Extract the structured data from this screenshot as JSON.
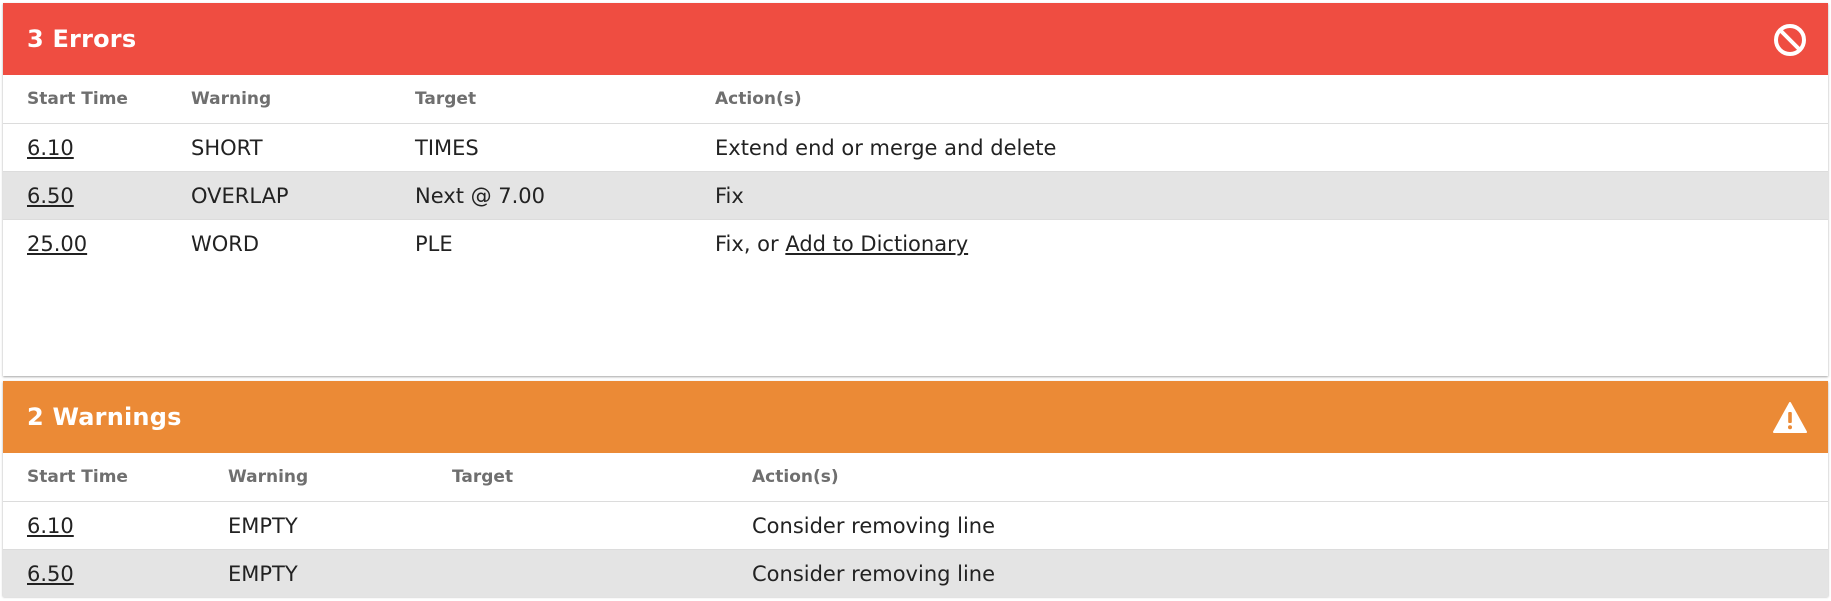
{
  "errors": {
    "title": "3 Errors",
    "header_color": "#ef4d41",
    "icon": "no-entry-icon",
    "columns": [
      "Start Time",
      "Warning",
      "Target",
      "Action(s)"
    ],
    "rows": [
      {
        "start_time": "6.10",
        "warning": "SHORT",
        "target": "TIMES",
        "action": "Extend end or merge and delete"
      },
      {
        "start_time": "6.50",
        "warning": "OVERLAP",
        "target": "Next @ 7.00",
        "action": "Fix"
      },
      {
        "start_time": "25.00",
        "warning": "WORD",
        "target": "PLE",
        "action_prefix": "Fix, or ",
        "action_link": "Add to Dictionary"
      }
    ]
  },
  "warnings": {
    "title": "2 Warnings",
    "header_color": "#eb8a36",
    "icon": "warning-triangle-icon",
    "columns": [
      "Start Time",
      "Warning",
      "Target",
      "Action(s)"
    ],
    "rows": [
      {
        "start_time": "6.10",
        "warning": "EMPTY",
        "target": "",
        "action": "Consider removing line"
      },
      {
        "start_time": "6.50",
        "warning": "EMPTY",
        "target": "",
        "action": "Consider removing line"
      }
    ]
  }
}
